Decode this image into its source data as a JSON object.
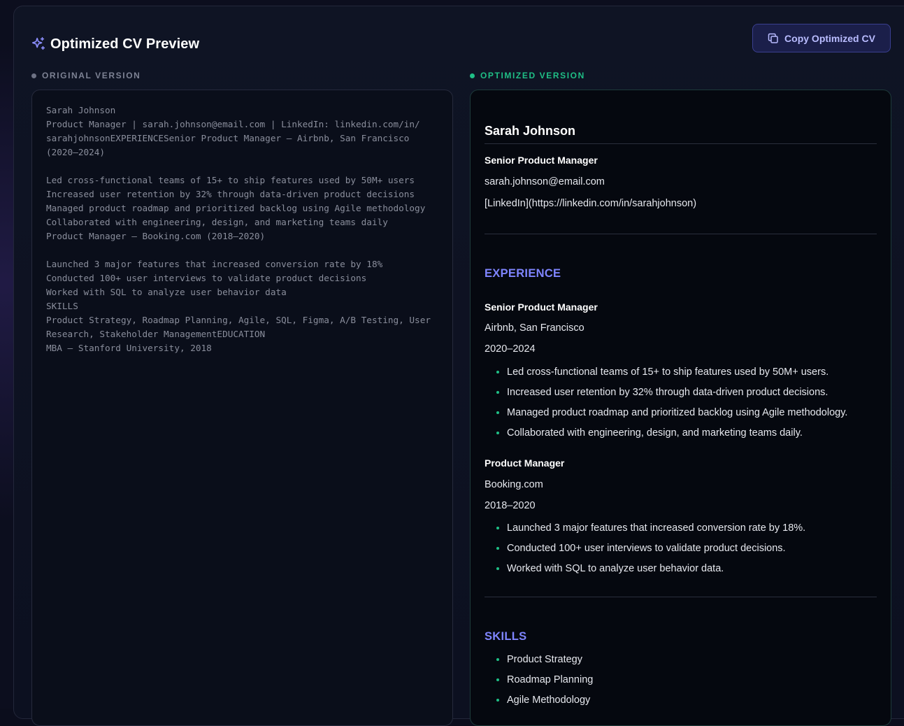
{
  "header": {
    "title": "Optimized CV Preview",
    "title_icon": "sparkles-icon",
    "copy_button_label": "Copy Optimized CV",
    "copy_button_icon": "copy-icon"
  },
  "original": {
    "label": "ORIGINAL VERSION",
    "text": "Sarah Johnson\nProduct Manager | sarah.johnson@email.com | LinkedIn: linkedin.com/in/\nsarahjohnsonEXPERIENCESenior Product Manager – Airbnb, San Francisco\n(2020–2024)\n\nLed cross-functional teams of 15+ to ship features used by 50M+ users\nIncreased user retention by 32% through data-driven product decisions\nManaged product roadmap and prioritized backlog using Agile methodology\nCollaborated with engineering, design, and marketing teams daily\nProduct Manager – Booking.com (2018–2020)\n\nLaunched 3 major features that increased conversion rate by 18%\nConducted 100+ user interviews to validate product decisions\nWorked with SQL to analyze user behavior data\nSKILLS\nProduct Strategy, Roadmap Planning, Agile, SQL, Figma, A/B Testing, User\nResearch, Stakeholder ManagementEDUCATION\nMBA – Stanford University, 2018"
  },
  "optimized": {
    "label": "OPTIMIZED VERSION",
    "name": "Sarah Johnson",
    "headline": "Senior Product Manager",
    "email": "sarah.johnson@email.com",
    "linkedin": "[LinkedIn](https://linkedin.com/in/sarahjohnson)",
    "experience_title": "EXPERIENCE",
    "jobs": [
      {
        "title": "Senior Product Manager",
        "company": "Airbnb, San Francisco",
        "dates": "2020–2024",
        "bullets": [
          "Led cross-functional teams of 15+ to ship features used by 50M+ users.",
          "Increased user retention by 32% through data-driven product decisions.",
          "Managed product roadmap and prioritized backlog using Agile methodology.",
          "Collaborated with engineering, design, and marketing teams daily."
        ]
      },
      {
        "title": "Product Manager",
        "company": "Booking.com",
        "dates": "2018–2020",
        "bullets": [
          "Launched 3 major features that increased conversion rate by 18%.",
          "Conducted 100+ user interviews to validate product decisions.",
          "Worked with SQL to analyze user behavior data."
        ]
      }
    ],
    "skills_title": "SKILLS",
    "skills": [
      "Product Strategy",
      "Roadmap Planning",
      "Agile Methodology"
    ]
  },
  "colors": {
    "accent": "#7f85ff",
    "success": "#1fbf86",
    "background": "#0c0e1e"
  }
}
